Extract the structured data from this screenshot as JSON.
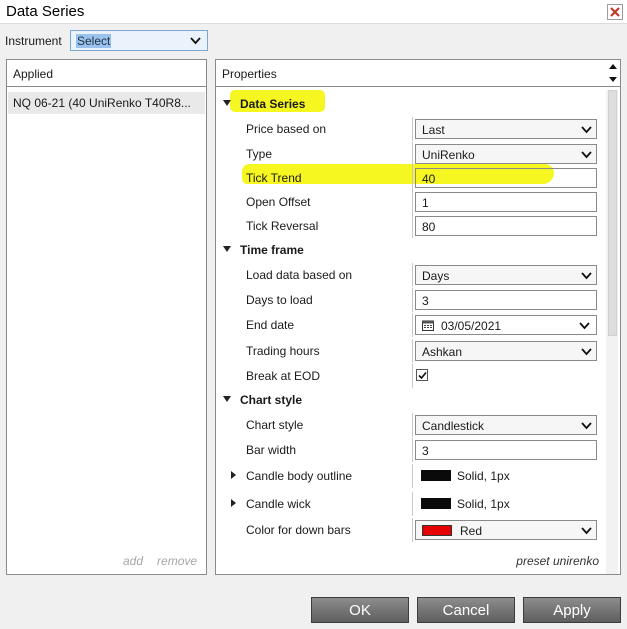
{
  "window": {
    "title": "Data Series"
  },
  "instrument": {
    "label": "Instrument",
    "value": "Select"
  },
  "applied": {
    "header": "Applied",
    "item": "NQ 06-21 (40 UniRenko T40R8...",
    "add_label": "add",
    "remove_label": "remove"
  },
  "properties": {
    "header": "Properties",
    "data_series": {
      "title": "Data Series",
      "price_based_on": {
        "label": "Price based on",
        "value": "Last"
      },
      "type": {
        "label": "Type",
        "value": "UniRenko"
      },
      "tick_trend": {
        "label": "Tick Trend",
        "value": "40"
      },
      "open_offset": {
        "label": "Open Offset",
        "value": "1"
      },
      "tick_reversal": {
        "label": "Tick Reversal",
        "value": "80"
      }
    },
    "time_frame": {
      "title": "Time frame",
      "load_data_based_on": {
        "label": "Load data based on",
        "value": "Days"
      },
      "days_to_load": {
        "label": "Days to load",
        "value": "3"
      },
      "end_date": {
        "label": "End date",
        "value": "03/05/2021"
      },
      "trading_hours": {
        "label": "Trading hours",
        "value": "Ashkan"
      },
      "break_at_eod": {
        "label": "Break at EOD",
        "checked": true
      }
    },
    "chart_style": {
      "title": "Chart style",
      "chart_style": {
        "label": "Chart style",
        "value": "Candlestick"
      },
      "bar_width": {
        "label": "Bar width",
        "value": "3"
      },
      "candle_body_outline": {
        "label": "Candle body outline",
        "value": "Solid, 1px",
        "color": "#0a0a0a"
      },
      "candle_wick": {
        "label": "Candle wick",
        "value": "Solid, 1px",
        "color": "#0a0a0a"
      },
      "color_for_down_bars": {
        "label": "Color for down bars",
        "value": "Red",
        "color": "#e60000"
      }
    },
    "preset": "preset unirenko"
  },
  "buttons": {
    "ok": "OK",
    "cancel": "Cancel",
    "apply": "Apply"
  },
  "colors": {
    "highlight": "#f6f621",
    "button": "#6f6f6f"
  }
}
